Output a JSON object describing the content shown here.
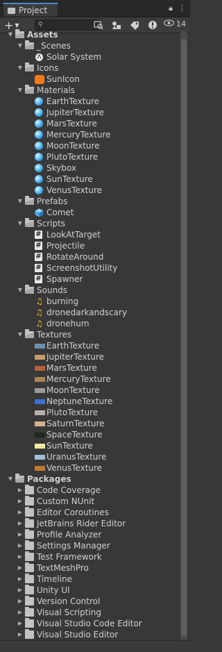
{
  "window": {
    "tab_title": "Project",
    "visibility_count": "14"
  },
  "toolbar": {
    "add_label": "+",
    "search_placeholder": ""
  },
  "assets": {
    "label": "Assets",
    "folders": [
      {
        "name": "_Scenes",
        "items": [
          {
            "name": "Solar System",
            "type": "scene"
          }
        ]
      },
      {
        "name": "Icons",
        "items": [
          {
            "name": "SunIcon",
            "type": "icon",
            "color": "#f07a1a"
          }
        ]
      },
      {
        "name": "Materials",
        "items": [
          {
            "name": "EarthTexture",
            "type": "material"
          },
          {
            "name": "JupiterTexture",
            "type": "material"
          },
          {
            "name": "MarsTexture",
            "type": "material"
          },
          {
            "name": "MercuryTexture",
            "type": "material"
          },
          {
            "name": "MoonTexture",
            "type": "material"
          },
          {
            "name": "PlutoTexture",
            "type": "material"
          },
          {
            "name": "Skybox",
            "type": "material"
          },
          {
            "name": "SunTexture",
            "type": "material"
          },
          {
            "name": "VenusTexture",
            "type": "material"
          }
        ]
      },
      {
        "name": "Prefabs",
        "items": [
          {
            "name": "Comet",
            "type": "prefab"
          }
        ]
      },
      {
        "name": "Scripts",
        "items": [
          {
            "name": "LookAtTarget",
            "type": "script"
          },
          {
            "name": "Projectile",
            "type": "script"
          },
          {
            "name": "RotateAround",
            "type": "script"
          },
          {
            "name": "ScreenshotUtility",
            "type": "script"
          },
          {
            "name": "Spawner",
            "type": "script"
          }
        ]
      },
      {
        "name": "Sounds",
        "items": [
          {
            "name": "burning",
            "type": "audio"
          },
          {
            "name": "dronedarkandscary",
            "type": "audio"
          },
          {
            "name": "dronehum",
            "type": "audio"
          }
        ]
      },
      {
        "name": "Textures",
        "items": [
          {
            "name": "EarthTexture",
            "type": "texture",
            "color": "#6f8fa8"
          },
          {
            "name": "JupiterTexture",
            "type": "texture",
            "color": "#c89a6a"
          },
          {
            "name": "MarsTexture",
            "type": "texture",
            "color": "#b4603a"
          },
          {
            "name": "MercuryTexture",
            "type": "texture",
            "color": "#a88456"
          },
          {
            "name": "MoonTexture",
            "type": "texture",
            "color": "#9a9a9a"
          },
          {
            "name": "NeptuneTexture",
            "type": "texture",
            "color": "#3f6fd0"
          },
          {
            "name": "PlutoTexture",
            "type": "texture",
            "color": "#b8b0a8"
          },
          {
            "name": "SaturnTexture",
            "type": "texture",
            "color": "#d6b48a"
          },
          {
            "name": "SpaceTexture",
            "type": "texture",
            "color": "#1e2a1e"
          },
          {
            "name": "SunTexture",
            "type": "texture",
            "color": "#f7eaa0"
          },
          {
            "name": "UranusTexture",
            "type": "texture",
            "color": "#9ec0d8"
          },
          {
            "name": "VenusTexture",
            "type": "texture",
            "color": "#c07a32"
          }
        ]
      }
    ]
  },
  "packages": {
    "label": "Packages",
    "items": [
      "Code Coverage",
      "Custom NUnit",
      "Editor Coroutines",
      "JetBrains Rider Editor",
      "Profile Analyzer",
      "Settings Manager",
      "Test Framework",
      "TextMeshPro",
      "Timeline",
      "Unity UI",
      "Version Control",
      "Visual Scripting",
      "Visual Studio Code Editor",
      "Visual Studio Editor"
    ]
  }
}
